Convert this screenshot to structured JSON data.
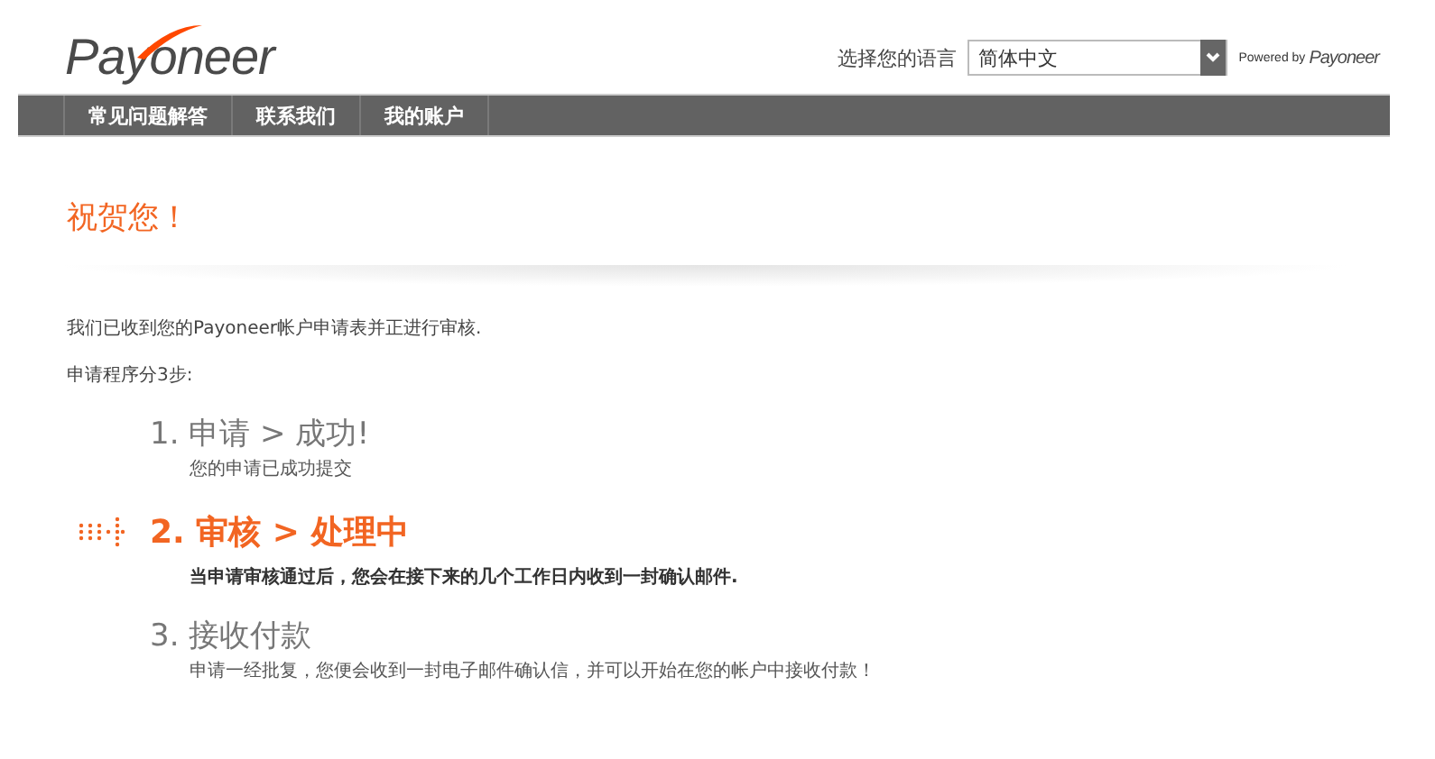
{
  "header": {
    "logo": "Payoneer",
    "language_label": "选择您的语言",
    "language_select": {
      "value": "简体中文"
    },
    "powered_by": "Powered by",
    "powered_logo": "Payoneer"
  },
  "nav": [
    {
      "label": "常见问题解答"
    },
    {
      "label": "联系我们"
    },
    {
      "label": "我的账户"
    }
  ],
  "title": "祝贺您！",
  "intro": [
    "我们已收到您的Payoneer帐户申请表并正进行审核.",
    "申请程序分3步:"
  ],
  "steps": [
    {
      "number": "1.",
      "title": "申请 > 成功!",
      "description": "您的申请已成功提交",
      "selected": false
    },
    {
      "number": "2.",
      "title": "审核 > 处理中",
      "description": "当申请审核通过后，您会在接下来的几个工作日内收到一封确认邮件.",
      "selected": true
    },
    {
      "number": "3.",
      "title": "接收付款",
      "description": "申请一经批复，您便会收到一封电子邮件确认信，并可以开始在您的帐户中接收付款！",
      "selected": false
    }
  ]
}
